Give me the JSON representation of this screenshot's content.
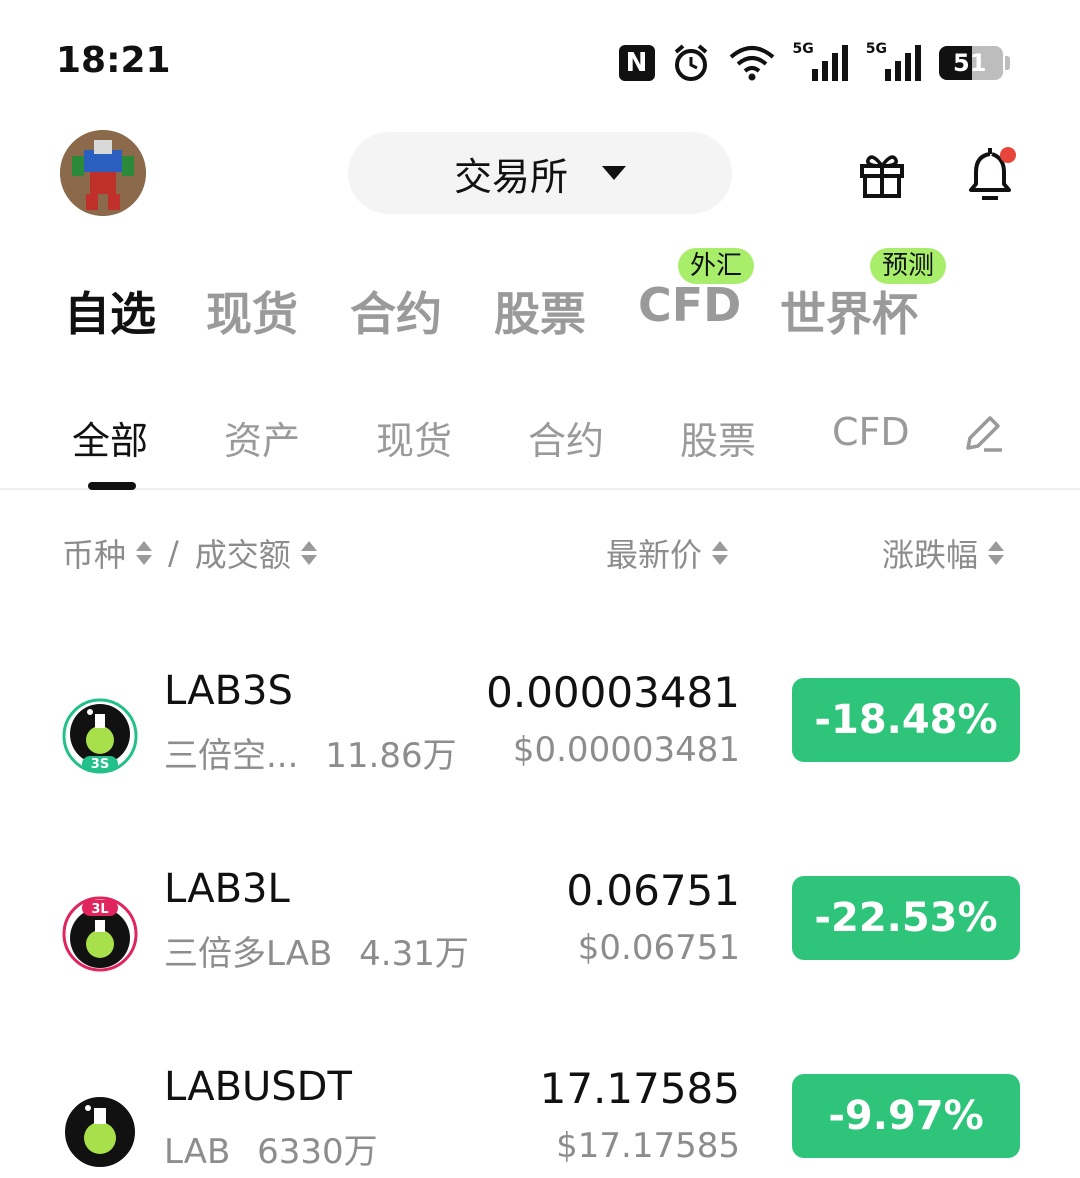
{
  "status_bar": {
    "time": "18:21",
    "nfc_label": "N",
    "net1_label": "5G",
    "net2_label": "5G",
    "battery_percent": "51",
    "battery_level": 0.51
  },
  "header": {
    "exchange_label": "交易所"
  },
  "main_tabs": [
    {
      "label": "自选",
      "active": true
    },
    {
      "label": "现货",
      "active": false
    },
    {
      "label": "合约",
      "active": false
    },
    {
      "label": "股票",
      "active": false
    },
    {
      "label": "CFD",
      "badge": "外汇"
    },
    {
      "label": "世界杯",
      "badge": "预测"
    }
  ],
  "sub_tabs": [
    {
      "label": "全部",
      "active": true
    },
    {
      "label": "资产"
    },
    {
      "label": "现货"
    },
    {
      "label": "合约"
    },
    {
      "label": "股票"
    },
    {
      "label": "CFD"
    }
  ],
  "columns": {
    "coin": "币种",
    "separator": "/",
    "volume": "成交额",
    "last_price": "最新价",
    "change": "涨跌幅"
  },
  "rows": [
    {
      "symbol": "LAB3S",
      "name": "三倍空...",
      "volume": "11.86万",
      "price": "0.00003481",
      "price_usd": "$0.00003481",
      "change": "-18.48%",
      "logo_tag": "3S",
      "logo_tag_color": "#23c08a"
    },
    {
      "symbol": "LAB3L",
      "name": "三倍多LAB",
      "volume": "4.31万",
      "price": "0.06751",
      "price_usd": "$0.06751",
      "change": "-22.53%",
      "logo_tag": "3L",
      "logo_tag_color": "#e0245e"
    },
    {
      "symbol": "LABUSDT",
      "name": "LAB",
      "volume": "6330万",
      "price": "17.17585",
      "price_usd": "$17.17585",
      "change": "-9.97%"
    }
  ],
  "colors": {
    "change_bg": "#2ec47a",
    "badge_bg": "#a8ee6b",
    "lime": "#a7e04a"
  }
}
